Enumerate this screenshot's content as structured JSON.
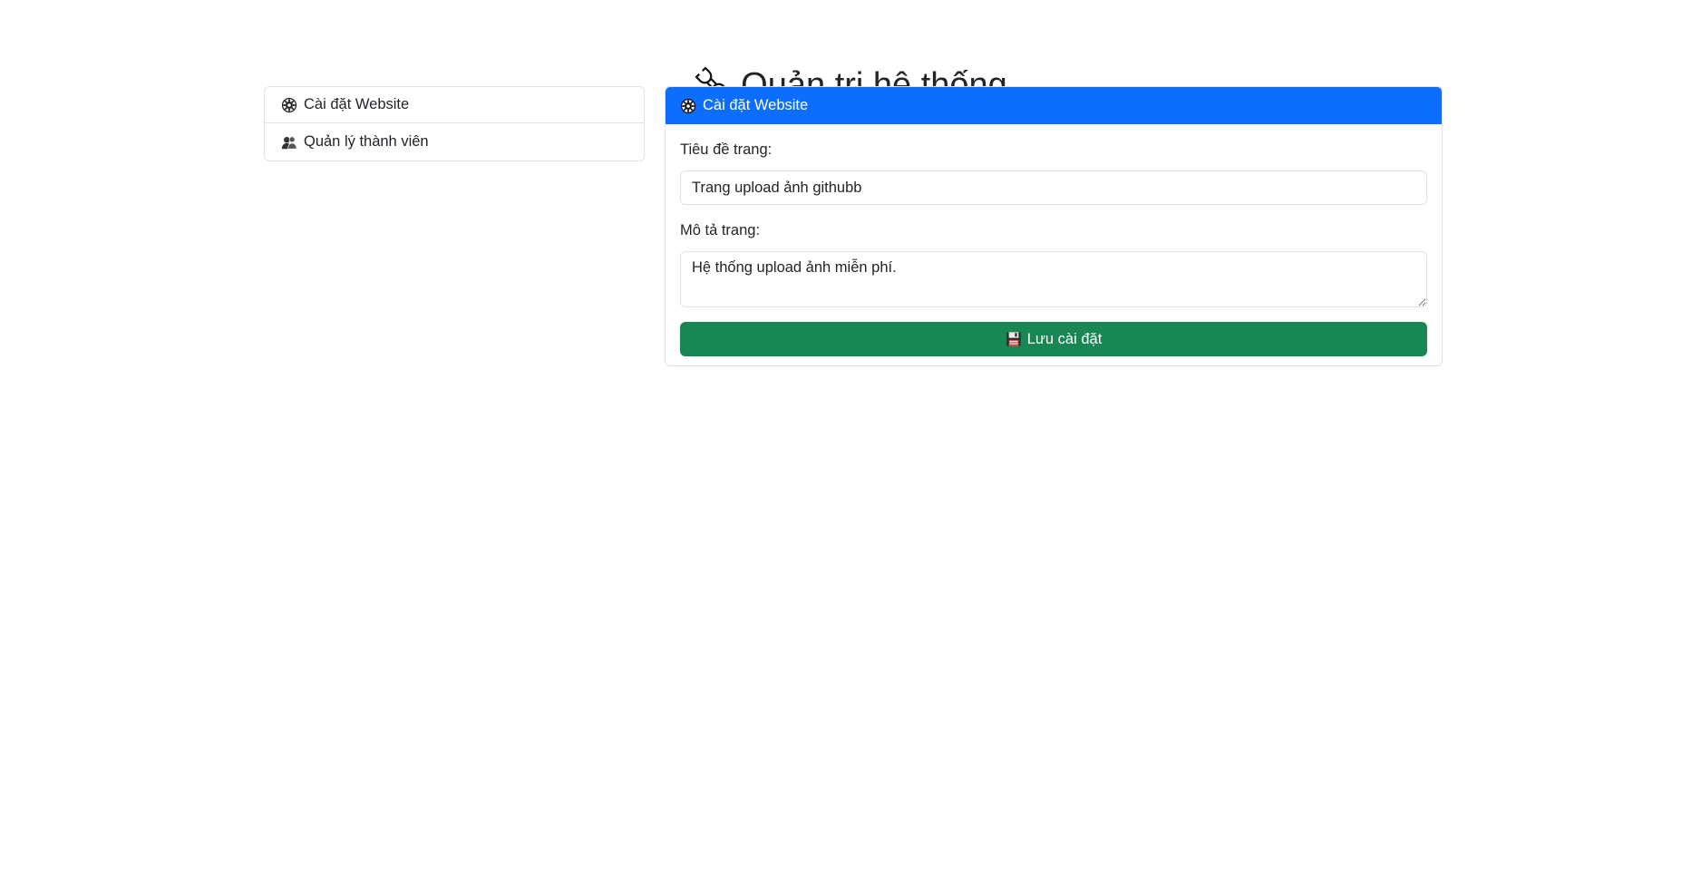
{
  "page": {
    "title": "Quản trị hệ thống",
    "title_icon": "wrench-icon"
  },
  "sidebar": {
    "items": [
      {
        "label": "Cài đặt Website",
        "icon": "gear-icon"
      },
      {
        "label": "Quản lý thành viên",
        "icon": "users-icon"
      }
    ]
  },
  "settings_card": {
    "header": "Cài đặt Website",
    "header_icon": "gear-icon",
    "site_title_label": "Tiêu đề trang:",
    "site_title_value": "Trang upload ảnh githubb",
    "site_desc_label": "Mô tả trang:",
    "site_desc_value": "Hệ thống upload ảnh miễn phí.",
    "save_label": "Lưu cài đặt",
    "save_icon": "floppy-disk-icon"
  },
  "colors": {
    "primary": "#0d6efd",
    "success": "#198754",
    "border": "#dee2e6",
    "text": "#212529"
  }
}
